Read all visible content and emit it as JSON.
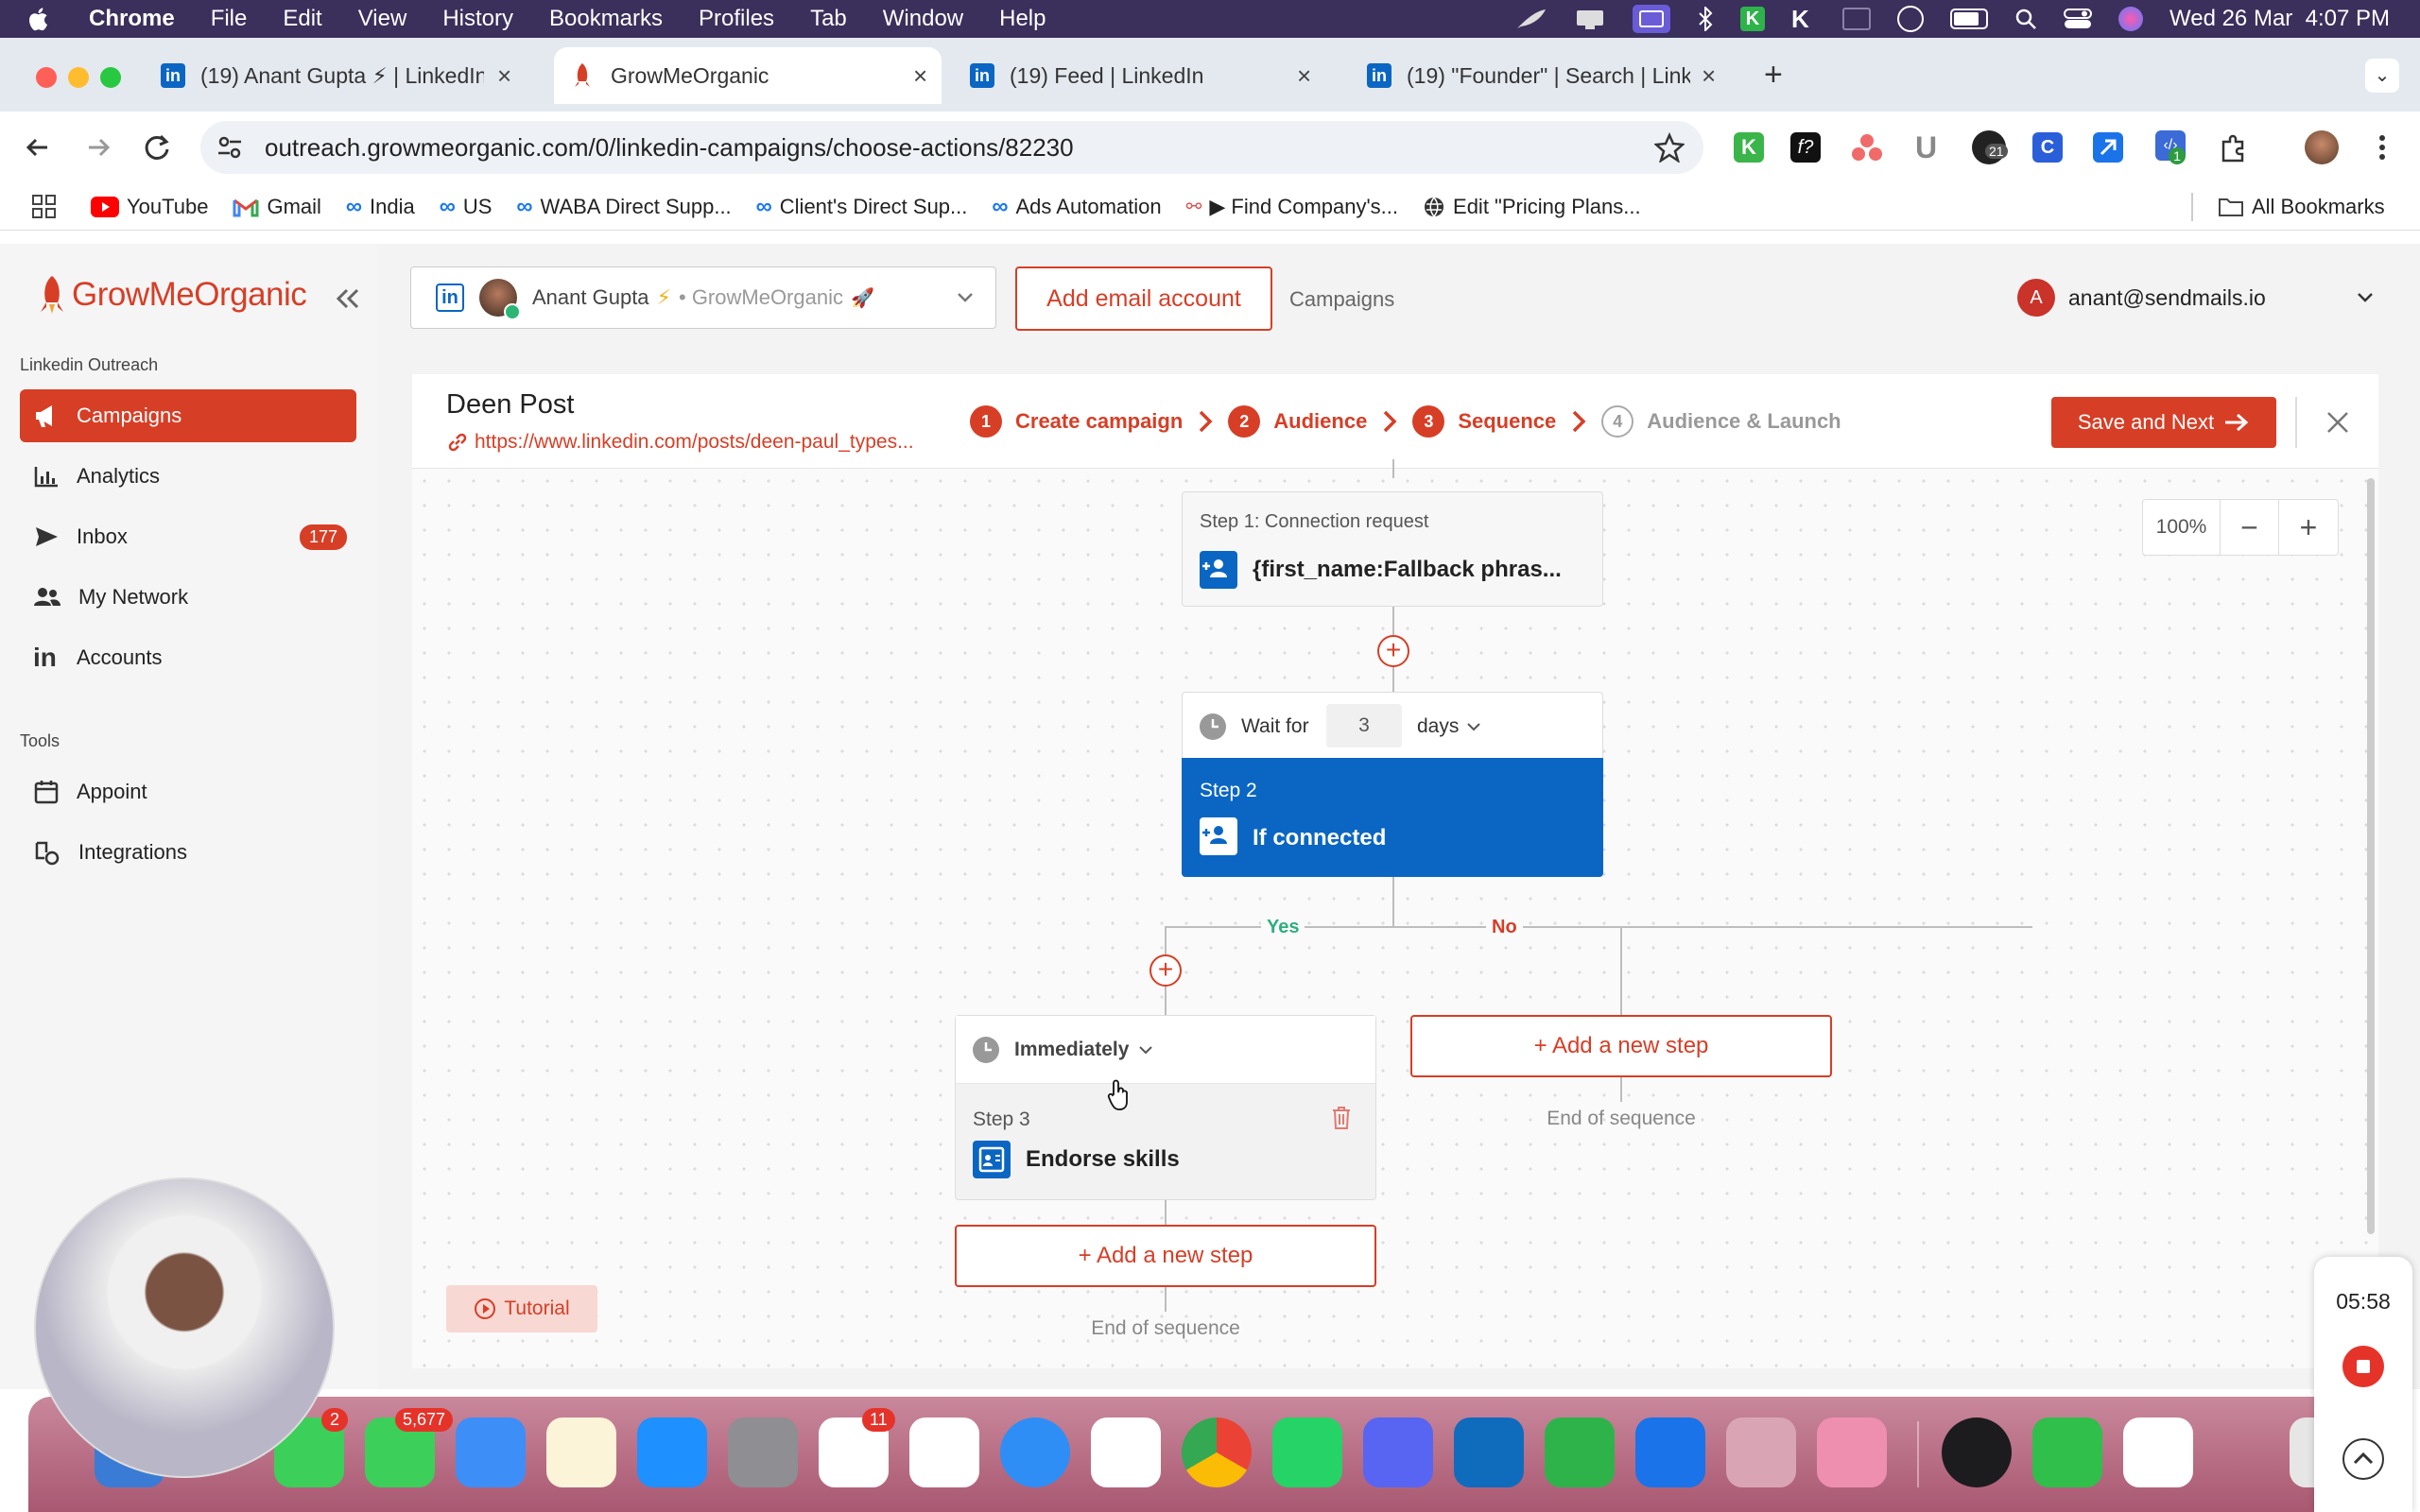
{
  "menubar": {
    "app": "Chrome",
    "items": [
      "File",
      "Edit",
      "View",
      "History",
      "Bookmarks",
      "Profiles",
      "Tab",
      "Window",
      "Help"
    ],
    "datetime": "Wed 26 Mar  4:07 PM"
  },
  "tabs": [
    {
      "title": "(19) Anant Gupta ⚡ | LinkedIn",
      "icon": "linkedin-icon"
    },
    {
      "title": "GrowMeOrganic",
      "icon": "growmeorganic-rocket-icon"
    },
    {
      "title": "(19) Feed | LinkedIn",
      "icon": "linkedin-icon"
    },
    {
      "title": "(19) \"Founder\" | Search | LinkedIn",
      "icon": "linkedin-icon"
    }
  ],
  "address": {
    "url": "outreach.growmeorganic.com/0/linkedin-campaigns/choose-actions/82230"
  },
  "extensions": {
    "badge_a": "21",
    "badge_b": "1"
  },
  "bookmarks": [
    "YouTube",
    "Gmail",
    "India",
    "US",
    "WABA Direct Supp...",
    "Client's Direct Sup...",
    "Ads Automation",
    "▶ Find Company's...",
    "Edit \"Pricing Plans..."
  ],
  "bookmarks_all": "All Bookmarks",
  "brand": {
    "name": "GrowMeOrganic",
    "accent": "#d73e26",
    "linkedin_blue": "#0a66c2"
  },
  "sidebar": {
    "section1": "Linkedin Outreach",
    "items": [
      {
        "label": "Campaigns",
        "icon": "megaphone-icon",
        "active": true
      },
      {
        "label": "Analytics",
        "icon": "bar-chart-icon"
      },
      {
        "label": "Inbox",
        "icon": "send-icon",
        "count": "177"
      },
      {
        "label": "My Network",
        "icon": "people-icon"
      },
      {
        "label": "Accounts",
        "icon": "linkedin-in-icon"
      }
    ],
    "section2": "Tools",
    "tools": [
      {
        "label": "Appoint",
        "icon": "calendar-icon"
      },
      {
        "label": "Integrations",
        "icon": "integrations-icon"
      }
    ]
  },
  "topbar": {
    "account_name": "Anant Gupta",
    "account_org": "• GrowMeOrganic",
    "add_email": "Add email account",
    "campaigns_link": "Campaigns",
    "user_initial": "A",
    "user_email": "anant@sendmails.io"
  },
  "campaign": {
    "name": "Deen Post",
    "post_url": "https://www.linkedin.com/posts/deen-paul_types...",
    "steps": [
      {
        "num": "1",
        "label": "Create campaign",
        "state": "done"
      },
      {
        "num": "2",
        "label": "Audience",
        "state": "done"
      },
      {
        "num": "3",
        "label": "Sequence",
        "state": "current"
      },
      {
        "num": "4",
        "label": "Audience & Launch",
        "state": "todo"
      }
    ],
    "save_next": "Save and Next"
  },
  "canvas": {
    "zoom": "100%",
    "step1": {
      "title": "Step 1: Connection request",
      "body": "{first_name:Fallback phras..."
    },
    "wait": {
      "label": "Wait for",
      "value": "3",
      "unit": "days"
    },
    "step2": {
      "title": "Step 2",
      "body": "If connected"
    },
    "yes": "Yes",
    "no": "No",
    "step3": {
      "timing": "Immediately",
      "title": "Step 3",
      "body": "Endorse skills"
    },
    "add_step": "+ Add a new step",
    "end": "End of sequence",
    "tutorial": "Tutorial"
  },
  "recorder": {
    "time": "05:58"
  },
  "dock_badges": {
    "facetime": "2",
    "messages": "5,677",
    "reminders": "11"
  }
}
